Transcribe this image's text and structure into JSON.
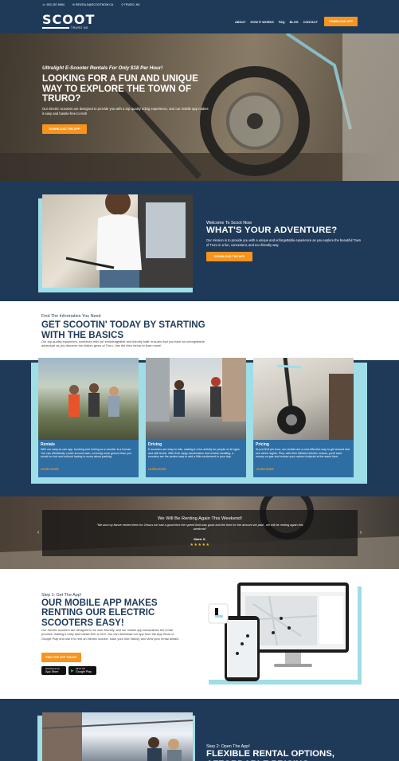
{
  "topbar": {
    "phone": "902-357-6584",
    "email": "RENTALS@SCOOTNOW.CA",
    "location": "TRURO, NS"
  },
  "header": {
    "logo": "SCOOT",
    "logo_sub": "TRURO NS",
    "nav": [
      "ABOUT",
      "HOW IT WORKS",
      "FAQ",
      "BLOG",
      "CONTACT"
    ],
    "cta": "DOWNLOAD APP"
  },
  "hero": {
    "subtitle": "Ultralight E-Scooter Rentals For Only $18 Per Hour!",
    "title": "LOOKING FOR A FUN AND UNIQUE WAY TO EXPLORE THE TOWN OF TRURO?",
    "description": "Our electric scooters are designed to provide you with a top-quality riding experience, and our mobile app makes it easy and hassle-free to rent!",
    "button": "DOWNLOAD THE APP"
  },
  "adventure": {
    "welcome": "Welcome To Scoot Now",
    "title": "WHAT'S YOUR ADVENTURE?",
    "description": "Our mission is to provide you with a unique and unforgettable experience as you explore the beautiful Town of Truro in a fun, convenient, and eco-friendly way.",
    "button": "DOWNLOAD THE APP"
  },
  "basics": {
    "kicker": "Find The Information You Need",
    "title": "GET SCOOTIN' TODAY BY STARTING WITH THE BASICS",
    "description": "Our top-quality equipment, combined with our knowledgeable and friendly staff, ensures that you have an unforgettable adventure as you discover the hidden gems of Truro. Use the links below to learn more!",
    "cards": [
      {
        "title": "Rentals",
        "text": "With our easy-to-use app, booking and renting an e-scooter is a breeze. You can effortlessly cruise around town, covering more ground than you would on foot and without having to worry about parking.",
        "link": "LEARN MORE"
      },
      {
        "title": "Driving",
        "text": "E-scooters are easy to ride, making it a fun activity for people of all ages and skill levels. With their zippy acceleration and nimble handling, e-scooters are the perfect way to add a little excitement to your day.",
        "link": "LEARN MORE"
      },
      {
        "title": "Pricing",
        "text": "At just $18 per hour, our rentals are a cost-effective way to get around and see all the sights. Plus, with their efficient electric motors, you'll save money on gas and reduce your carbon footprint at the same time.",
        "link": "LEARN MORE"
      }
    ]
  },
  "testimonial": {
    "title": "We Will Be Renting Again This Weekend!",
    "quote": "\"Me and my fiancé rented them for 2hours we had a good time the speed limit was good and the time for the amount we paid , we will be renting again this weekend\"",
    "name": "Marie S.",
    "stars": "★★★★★"
  },
  "app": {
    "step": "Step 1: Get The App!",
    "title": "OUR MOBILE APP MAKES RENTING OUR ELECTRIC SCOOTERS EASY!",
    "description": "Our electric scooters are designed to be user-friendly, and our mobile app streamlines the rental process, making it easy and hassle-free to rent. You can download our app from the App Store or Google Play and use it to rent an electric scooter, track your ride history, and view your rental details.",
    "button": "FIND THE APP TODAY!",
    "app_store": "App Store",
    "google_play": "Google Play",
    "app_store_pre": "Download on the",
    "google_play_pre": "GET IT ON"
  },
  "flexible": {
    "step": "Step 2: Open The App!",
    "title": "FLEXIBLE RENTAL OPTIONS, AFFORDABLE PRICING"
  },
  "colors": {
    "navy": "#1f3a58",
    "orange": "#f7941d",
    "light_blue": "#9fdde7",
    "card_blue": "#2f6ea3"
  }
}
